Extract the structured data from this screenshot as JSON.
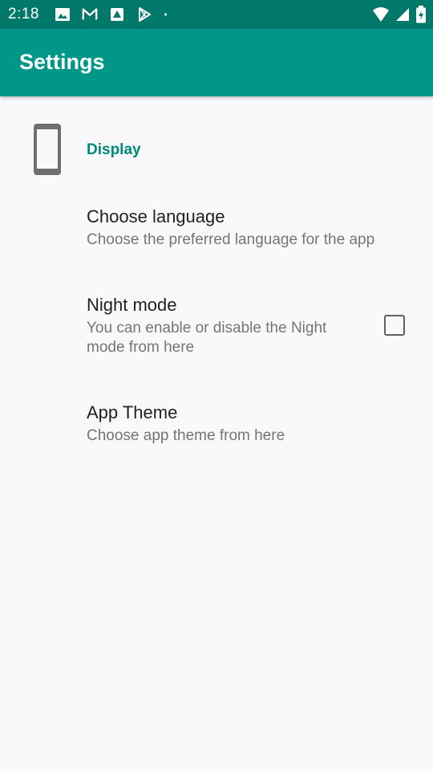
{
  "status_bar": {
    "time": "2:18",
    "icons_left": [
      "image-icon",
      "gmail-icon",
      "drive-icon",
      "play-store-icon",
      "dot-icon"
    ],
    "icons_right": [
      "wifi-icon",
      "signal-icon",
      "battery-icon"
    ]
  },
  "app_bar": {
    "title": "Settings"
  },
  "category": {
    "icon": "phone-icon",
    "title": "Display"
  },
  "prefs": [
    {
      "title": "Choose language",
      "summary": "Choose the preferred language for the app"
    },
    {
      "title": "Night mode",
      "summary_line1": "You can enable or disable the Night",
      "summary_line2": "mode from here",
      "checked": false
    },
    {
      "title": "App Theme",
      "summary": "Choose app theme from here"
    }
  ],
  "colors": {
    "status_bar": "#00796b",
    "app_bar": "#009688",
    "accent": "#00897b",
    "background": "#f9f9fb"
  }
}
